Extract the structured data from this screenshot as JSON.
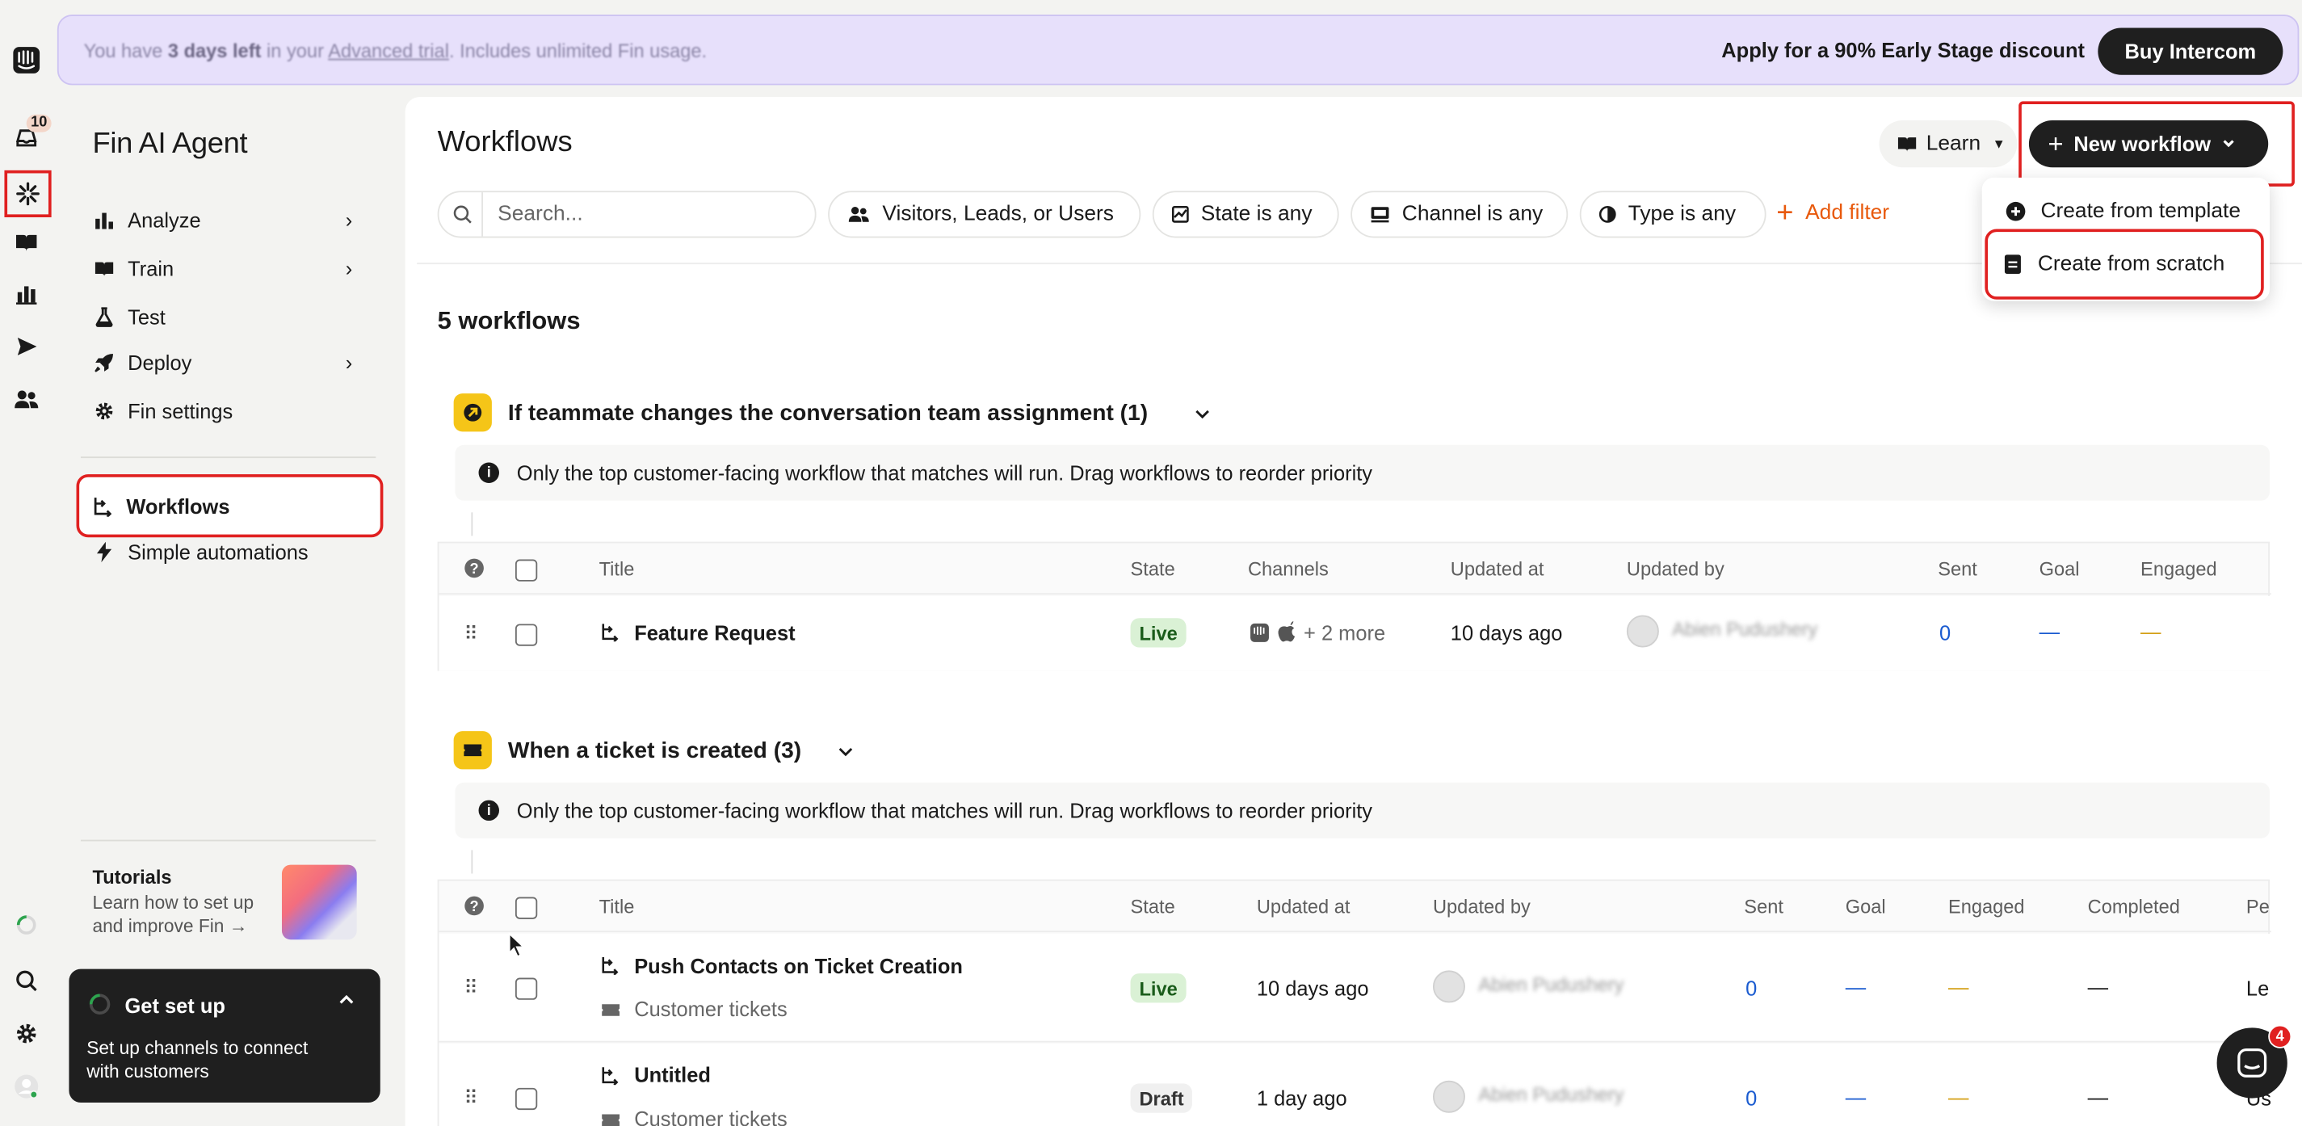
{
  "banner": {
    "trial_prefix": "You have ",
    "trial_days": "3 days left",
    "trial_mid": " in your ",
    "trial_link": "Advanced trial",
    "trial_suffix": ". Includes unlimited Fin usage.",
    "discount": "Apply for a 90% Early Stage discount",
    "buy_label": "Buy Intercom"
  },
  "rail": {
    "inbox_badge": "10",
    "messenger_badge": "4",
    "icons": [
      "intercom-logo-icon",
      "inbox-icon",
      "fin-ai-icon",
      "book-icon",
      "reports-icon",
      "send-icon",
      "contacts-icon",
      "progress-icon",
      "search-icon",
      "settings-icon",
      "user-avatar-icon"
    ]
  },
  "sidebar": {
    "title": "Fin AI Agent",
    "items": [
      {
        "label": "Analyze",
        "icon": "bar-chart-icon"
      },
      {
        "label": "Train",
        "icon": "book-icon"
      },
      {
        "label": "Test",
        "icon": "flask-icon"
      },
      {
        "label": "Deploy",
        "icon": "rocket-icon"
      },
      {
        "label": "Fin settings",
        "icon": "gear-icon"
      }
    ],
    "workflows_label": "Workflows",
    "automations_label": "Simple automations",
    "tutorials_title": "Tutorials",
    "tutorials_text_1": "Learn how to set up",
    "tutorials_text_2": "and improve Fin →",
    "getsetup_title": "Get set up",
    "getsetup_text_1": "Set up channels to connect",
    "getsetup_text_2": "with customers"
  },
  "header": {
    "title": "Workflows",
    "learn_label": "Learn",
    "new_workflow_label": "New workflow"
  },
  "filters": {
    "search_placeholder": "Search...",
    "audience": "Visitors, Leads, or Users",
    "state": "State is any",
    "channel": "Channel is any",
    "type": "Type is any",
    "add_filter": "Add filter"
  },
  "dropdown": {
    "template_label": "Create from template",
    "scratch_label": "Create from scratch"
  },
  "count_label": "5 workflows",
  "group1": {
    "title": "If teammate changes the conversation team assignment (1)",
    "info": "Only the top customer-facing workflow that matches will run. Drag workflows to reorder priority",
    "columns": [
      "Title",
      "State",
      "Channels",
      "Updated at",
      "Updated by",
      "Sent",
      "Goal",
      "Engaged"
    ],
    "row": {
      "title": "Feature Request",
      "state": "Live",
      "channels_more": "+ 2 more",
      "updated_at": "10 days ago",
      "updated_by": "Abien Pudushery",
      "sent": "0",
      "goal": "—",
      "engaged": "—"
    }
  },
  "group2": {
    "title": "When a ticket is created (3)",
    "info": "Only the top customer-facing workflow that matches will run. Drag workflows to reorder priority",
    "columns": [
      "Title",
      "State",
      "Updated at",
      "Updated by",
      "Sent",
      "Goal",
      "Engaged",
      "Completed",
      "Pe"
    ],
    "rows": [
      {
        "title": "Push Contacts on Ticket Creation",
        "subtitle": "Customer tickets",
        "state": "Live",
        "updated_at": "10 days ago",
        "updated_by": "Abien Pudushery",
        "sent": "0",
        "goal": "—",
        "engaged": "—",
        "completed": "—",
        "extra": "Le"
      },
      {
        "title": "Untitled",
        "subtitle": "Customer tickets",
        "state": "Draft",
        "updated_at": "1 day ago",
        "updated_by": "Abien Pudushery",
        "sent": "0",
        "goal": "—",
        "engaged": "—",
        "completed": "—",
        "extra": "Us"
      }
    ]
  },
  "colors": {
    "accent_orange": "#e8590c",
    "link_blue": "#1a5bd0",
    "engaged_amber": "#d4a017",
    "live_green": "#daf1d5",
    "highlight_red": "#e02020"
  }
}
